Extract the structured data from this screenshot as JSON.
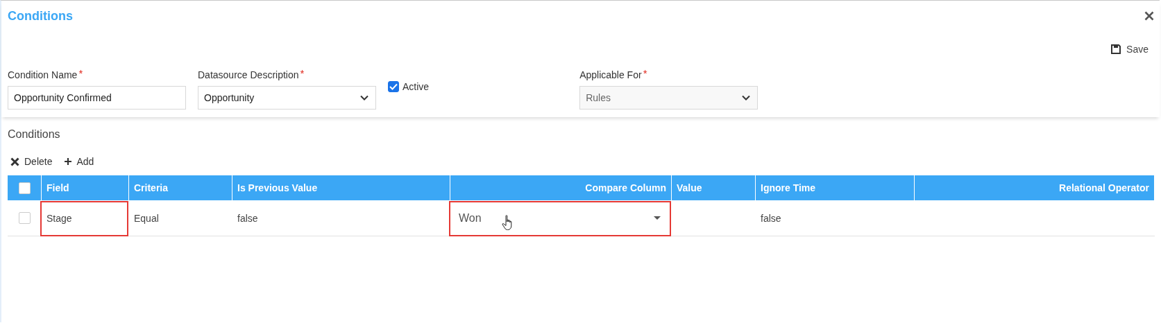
{
  "dialog": {
    "title": "Conditions"
  },
  "save_button": {
    "label": "Save"
  },
  "form": {
    "condition_name": {
      "label": "Condition Name",
      "required_marker": "*",
      "value": "Opportunity Confirmed"
    },
    "datasource": {
      "label": "Datasource Description",
      "required_marker": "*",
      "value": "Opportunity"
    },
    "active": {
      "label": "Active",
      "checked": true
    },
    "applicable_for": {
      "label": "Applicable For",
      "required_marker": "*",
      "value": "Rules",
      "disabled": true
    }
  },
  "section": {
    "title": "Conditions"
  },
  "toolbar": [
    {
      "kind": "delete",
      "label": "Delete"
    },
    {
      "kind": "add",
      "label": "Add"
    }
  ],
  "table": {
    "select_all_checked": false,
    "columns": [
      {
        "label": "Field"
      },
      {
        "label": "Criteria"
      },
      {
        "label": "Is Previous Value"
      },
      {
        "label": "Compare Column"
      },
      {
        "label": "Value"
      },
      {
        "label": "Ignore Time"
      },
      {
        "label": "Relational Operator"
      }
    ],
    "rows": [
      {
        "selected": false,
        "cells": [
          {
            "kind": "text",
            "text": "Stage",
            "highlighted": true
          },
          {
            "kind": "text",
            "text": "Equal",
            "highlighted": false
          },
          {
            "kind": "text",
            "text": "false",
            "highlighted": false
          },
          {
            "kind": "dropdown",
            "text": "Won",
            "highlighted": true
          },
          {
            "kind": "text",
            "highlighted": false
          },
          {
            "kind": "text",
            "text": "false",
            "highlighted": false
          },
          {
            "kind": "text",
            "highlighted": false
          }
        ]
      }
    ]
  }
}
